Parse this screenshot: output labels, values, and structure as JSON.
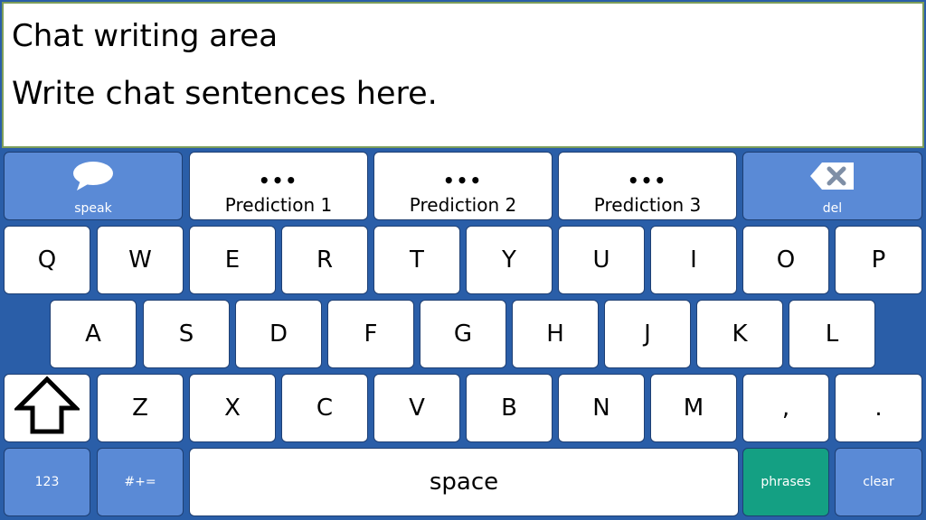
{
  "writing_area": {
    "title": "Chat writing area",
    "text": "Write chat sentences here."
  },
  "top_row": {
    "speak_label": "speak",
    "predictions": [
      "Prediction 1",
      "Prediction 2",
      "Prediction 3"
    ],
    "prediction_dots": "•••",
    "del_label": "del"
  },
  "rows": {
    "row1": [
      "Q",
      "W",
      "E",
      "R",
      "T",
      "Y",
      "U",
      "I",
      "O",
      "P"
    ],
    "row2": [
      "A",
      "S",
      "D",
      "F",
      "G",
      "H",
      "J",
      "K",
      "L"
    ],
    "row3": [
      "Z",
      "X",
      "C",
      "V",
      "B",
      "N",
      "M",
      ",",
      "."
    ]
  },
  "bottom_row": {
    "numbers_label": "123",
    "symbols_label": "#+=",
    "space_label": "space",
    "phrases_label": "phrases",
    "clear_label": "clear"
  },
  "colors": {
    "keyboard_bg": "#2a5ea8",
    "key_white": "#ffffff",
    "key_blue": "#5a8ad6",
    "key_green": "#14a083",
    "writing_border": "#7d9e5a"
  },
  "icons": {
    "speak": "speech-bubble-icon",
    "delete": "backspace-icon",
    "shift": "shift-arrow-icon"
  }
}
